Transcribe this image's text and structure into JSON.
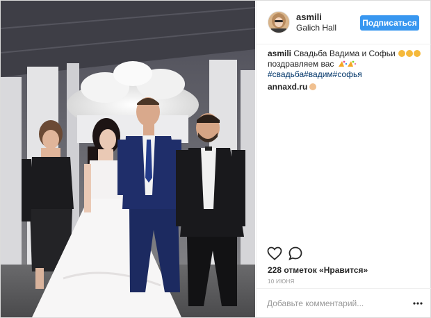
{
  "post": {
    "username": "asmili",
    "location": "Galich Hall",
    "follow_label": "Подписаться",
    "caption": {
      "username": "asmili",
      "text": "Свадьба Вадима и Софьи",
      "line2": "поздравляем вас",
      "hashtags": [
        "#свадьба",
        "#вадим",
        "#софья"
      ]
    },
    "comment_link": "annaxd.ru",
    "likes": "228 отметок «Нравится»",
    "date": "10 июня",
    "comment_placeholder": "Добавьте комментарий...",
    "icons": {
      "like": "heart-icon",
      "comment": "comment-bubble-icon",
      "options": "more-dots-icon"
    },
    "colors": {
      "accent": "#3897f0",
      "hashtag": "#003569",
      "secondary_text": "#999999"
    }
  }
}
